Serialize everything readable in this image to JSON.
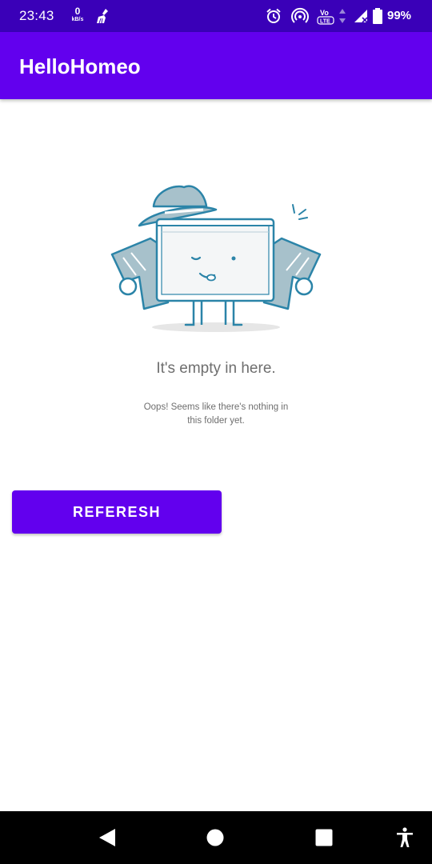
{
  "status_bar": {
    "time": "23:43",
    "net_speed_value": "0",
    "net_speed_unit": "kB/s",
    "battery": "99%",
    "icons": [
      "cleaner-icon",
      "alarm-icon",
      "hotspot-icon",
      "volte-icon",
      "data-arrows-icon",
      "signal-icon",
      "battery-icon"
    ]
  },
  "app_bar": {
    "title": "HelloHomeo",
    "color": "#6200ee"
  },
  "empty_state": {
    "illustration": "folder-detective-illustration",
    "title": "It's empty in here.",
    "message": "Oops! Seems like there's nothing in this folder yet."
  },
  "actions": {
    "refresh_label": "REFERESH"
  },
  "nav_bar": {
    "icons": [
      "back-icon",
      "home-icon",
      "recents-icon",
      "accessibility-icon"
    ]
  }
}
